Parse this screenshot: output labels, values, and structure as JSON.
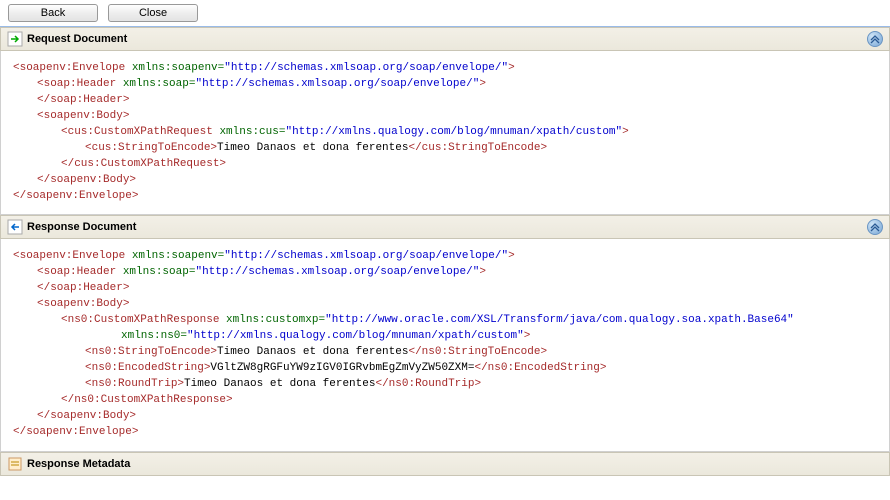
{
  "toolbar": {
    "back_label": "Back",
    "close_label": "Close"
  },
  "panels": {
    "request": {
      "title": "Request Document"
    },
    "response": {
      "title": "Response Document"
    },
    "metadata": {
      "title": "Response Metadata"
    }
  },
  "xml": {
    "soapenv_ns": "http://schemas.xmlsoap.org/soap/envelope/",
    "soap_ns": "http://schemas.xmlsoap.org/soap/envelope/",
    "cus_ns": "http://xmlns.qualogy.com/blog/mnuman/xpath/custom",
    "customxp_ns": "http://www.oracle.com/XSL/Transform/java/com.qualogy.soa.xpath.Base64",
    "ns0_ns": "http://xmlns.qualogy.com/blog/mnuman/xpath/custom",
    "string_to_encode": "Timeo Danaos et dona ferentes",
    "encoded_string": "VGltZW8gRGFuYW9zIGV0IGRvbmEgZmVyZW50ZXM=",
    "round_trip": "Timeo Danaos et dona ferentes"
  }
}
